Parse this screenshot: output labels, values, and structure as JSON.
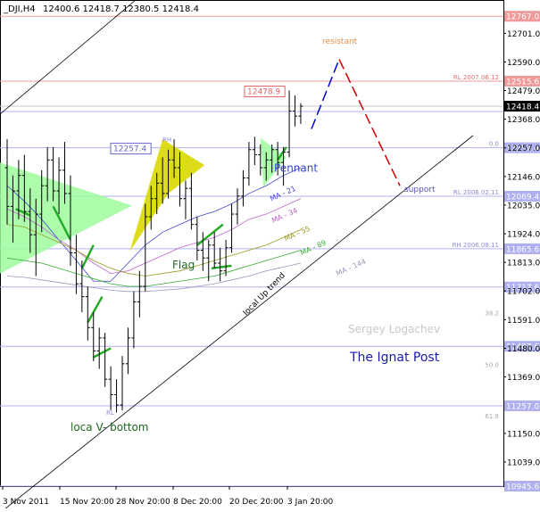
{
  "header": {
    "symbol": "_DJI,H4",
    "ohlc": "12400.6 12418.7 12380.5 12418.4"
  },
  "chart_data": {
    "type": "candlestick",
    "grid": false,
    "ylim": [
      10945.6,
      12767.8
    ],
    "y_ticks": [
      {
        "value": 12767.0,
        "label": "12767.0",
        "boxed": true,
        "kind": "red"
      },
      {
        "value": 12701.0,
        "label": "12701.0"
      },
      {
        "value": 12590.0,
        "label": "12590.0"
      },
      {
        "value": 12515.6,
        "label": "12515.6",
        "boxed": true,
        "kind": "red"
      },
      {
        "value": 12479.0,
        "label": "12479.0"
      },
      {
        "value": 12418.4,
        "label": "12418.4",
        "boxed": true,
        "kind": "current"
      },
      {
        "value": 12368.0,
        "label": "12368.0"
      },
      {
        "value": 12257.4,
        "label": "12257.4",
        "boxed": true,
        "kind": "blue"
      },
      {
        "value": 12257.0,
        "label": "12257.0"
      },
      {
        "value": 12146.0,
        "label": "12146.0"
      },
      {
        "value": 12069.4,
        "label": "12069.4",
        "boxed": true,
        "kind": "blue"
      },
      {
        "value": 12035.0,
        "label": "12035.0"
      },
      {
        "value": 11924.0,
        "label": "11924.0"
      },
      {
        "value": 11865.6,
        "label": "11865.6",
        "boxed": true,
        "kind": "blue"
      },
      {
        "value": 11813.0,
        "label": "11813.0"
      },
      {
        "value": 11717.6,
        "label": "11717.6",
        "boxed": true,
        "kind": "blue"
      },
      {
        "value": 11702.0,
        "label": "11702.0"
      },
      {
        "value": 11591.0,
        "label": "11591.0"
      },
      {
        "value": 11487.6,
        "label": "11487.6",
        "boxed": true,
        "kind": "blue"
      },
      {
        "value": 11480.0,
        "label": "11480.0"
      },
      {
        "value": 11369.0,
        "label": "11369.0"
      },
      {
        "value": 11257.0,
        "label": "11257.0",
        "boxed": true,
        "kind": "blue"
      },
      {
        "value": 11150.0,
        "label": "11150.0"
      },
      {
        "value": 11039.0,
        "label": "11039.0"
      },
      {
        "value": 10945.6,
        "label": "10945.6",
        "boxed": true,
        "kind": "blue"
      }
    ],
    "x_ticks": [
      "3 Nov 2011",
      "15 Nov 20:00",
      "28 Nov 20:00",
      "8 Dec 20:00",
      "20 Dec 20:00",
      "3 Jan 20:00"
    ],
    "horizontal_levels": [
      {
        "value": 12767.0,
        "color": "#ef9a9a"
      },
      {
        "value": 12515.6,
        "color": "#ef9a9a",
        "label": "RL 2007.06.12"
      },
      {
        "value": 12418.4,
        "color": "#c8c8c8"
      },
      {
        "value": 12398.0,
        "color": "#b0b0f0"
      },
      {
        "value": 12257.4,
        "color": "#b0b0f0",
        "label": "0.0"
      },
      {
        "value": 12069.4,
        "color": "#b0b0f0",
        "label": "RL 2006.02.11"
      },
      {
        "value": 11865.6,
        "color": "#b0b0f0",
        "label": "RH 2006.08.11"
      },
      {
        "value": 11717.6,
        "color": "#b0b0f0"
      },
      {
        "value": 11487.6,
        "color": "#b0b0f0"
      },
      {
        "value": 11257.0,
        "color": "#b0b0f0"
      },
      {
        "value": 10945.6,
        "color": "#b0b0f0"
      }
    ],
    "fib_labels": [
      {
        "value": 11608.0,
        "label": "38.2"
      },
      {
        "value": 11407.0,
        "label": "50.0"
      },
      {
        "value": 11208.0,
        "label": "61.8"
      }
    ],
    "candles": [
      {
        "x": "3 Nov 2011",
        "o": 12180,
        "h": 12290,
        "l": 11960,
        "c": 12030
      },
      {
        "o": 12030,
        "h": 12150,
        "l": 11890,
        "c": 12090
      },
      {
        "o": 12090,
        "h": 12210,
        "l": 11980,
        "c": 12150
      },
      {
        "o": 12150,
        "h": 12230,
        "l": 11970,
        "c": 12010
      },
      {
        "o": 12010,
        "h": 12100,
        "l": 11850,
        "c": 11920
      },
      {
        "o": 11920,
        "h": 12060,
        "l": 11760,
        "c": 12000
      },
      {
        "o": 12000,
        "h": 12170,
        "l": 11930,
        "c": 12110
      },
      {
        "o": 12110,
        "h": 12260,
        "l": 12050,
        "c": 12210
      },
      {
        "o": 12210,
        "h": 12260,
        "l": 12050,
        "c": 12090
      },
      {
        "o": 12090,
        "h": 12220,
        "l": 12000,
        "c": 12170
      },
      {
        "o": 12170,
        "h": 12280,
        "l": 12040,
        "c": 12080
      },
      {
        "x": "15 Nov 20:00",
        "o": 12080,
        "h": 12150,
        "l": 11800,
        "c": 11850
      },
      {
        "o": 11850,
        "h": 11920,
        "l": 11690,
        "c": 11730
      },
      {
        "o": 11730,
        "h": 11820,
        "l": 11620,
        "c": 11680
      },
      {
        "o": 11680,
        "h": 11720,
        "l": 11510,
        "c": 11560
      },
      {
        "o": 11560,
        "h": 11620,
        "l": 11430,
        "c": 11470
      },
      {
        "o": 11470,
        "h": 11560,
        "l": 11400,
        "c": 11520
      },
      {
        "o": 11520,
        "h": 11540,
        "l": 11330,
        "c": 11360
      },
      {
        "o": 11360,
        "h": 11410,
        "l": 11240,
        "c": 11300
      },
      {
        "o": 11300,
        "h": 11360,
        "l": 11231,
        "c": 11260
      },
      {
        "o": 11260,
        "h": 11450,
        "l": 11240,
        "c": 11420
      },
      {
        "o": 11420,
        "h": 11560,
        "l": 11380,
        "c": 11520
      },
      {
        "x": "28 Nov 20:00",
        "o": 11520,
        "h": 11700,
        "l": 11480,
        "c": 11660
      },
      {
        "o": 11660,
        "h": 11780,
        "l": 11600,
        "c": 11720
      },
      {
        "o": 11720,
        "h": 12040,
        "l": 11700,
        "c": 11990
      },
      {
        "o": 11990,
        "h": 12110,
        "l": 11940,
        "c": 12060
      },
      {
        "o": 12060,
        "h": 12160,
        "l": 12000,
        "c": 12120
      },
      {
        "o": 12120,
        "h": 12220,
        "l": 12040,
        "c": 12080
      },
      {
        "o": 12080,
        "h": 12250,
        "l": 12060,
        "c": 12210
      },
      {
        "o": 12210,
        "h": 12290,
        "l": 12140,
        "c": 12180
      },
      {
        "o": 12180,
        "h": 12240,
        "l": 12030,
        "c": 12060
      },
      {
        "o": 12060,
        "h": 12130,
        "l": 11980,
        "c": 12100
      },
      {
        "x": "8 Dec 20:00",
        "o": 12100,
        "h": 12160,
        "l": 11940,
        "c": 11960
      },
      {
        "o": 11960,
        "h": 11990,
        "l": 11820,
        "c": 11860
      },
      {
        "o": 11860,
        "h": 11930,
        "l": 11780,
        "c": 11830
      },
      {
        "o": 11830,
        "h": 11900,
        "l": 11740,
        "c": 11880
      },
      {
        "o": 11880,
        "h": 11930,
        "l": 11790,
        "c": 11810
      },
      {
        "o": 11810,
        "h": 11870,
        "l": 11740,
        "c": 11780
      },
      {
        "o": 11780,
        "h": 11900,
        "l": 11760,
        "c": 11870
      },
      {
        "o": 11870,
        "h": 12040,
        "l": 11850,
        "c": 12000
      },
      {
        "o": 12000,
        "h": 12100,
        "l": 11960,
        "c": 12070
      },
      {
        "o": 12070,
        "h": 12170,
        "l": 12030,
        "c": 12140
      },
      {
        "x": "20 Dec 20:00",
        "o": 12140,
        "h": 12280,
        "l": 12110,
        "c": 12250
      },
      {
        "o": 12250,
        "h": 12300,
        "l": 12190,
        "c": 12230
      },
      {
        "o": 12230,
        "h": 12270,
        "l": 12150,
        "c": 12180
      },
      {
        "o": 12180,
        "h": 12240,
        "l": 12130,
        "c": 12210
      },
      {
        "o": 12210,
        "h": 12270,
        "l": 12160,
        "c": 12250
      },
      {
        "o": 12250,
        "h": 12280,
        "l": 12150,
        "c": 12200
      },
      {
        "o": 12200,
        "h": 12260,
        "l": 12110,
        "c": 12240
      },
      {
        "x": "3 Jan 20:00",
        "o": 12240,
        "h": 12479,
        "l": 12220,
        "c": 12400
      },
      {
        "o": 12400,
        "h": 12460,
        "l": 12340,
        "c": 12380
      },
      {
        "o": 12380,
        "h": 12430,
        "l": 12350,
        "c": 12418.4
      }
    ],
    "annotations": {
      "resistant": "resistant",
      "support": "support",
      "pennant": "Pennant",
      "flag": "Flag",
      "bottom": "loca V- bottom",
      "uptrend": "local Up trend",
      "author": "Sergey Logachev",
      "brand": "The Ignat Post",
      "rh": "RH",
      "rl": "RL",
      "box_12478": "12478.9",
      "box_12257": "12257.4",
      "ma21": "MA - 21",
      "ma34": "MA - 34",
      "ma55": "MA - 55",
      "ma89": "MA - 89",
      "ma144": "MA - 144"
    },
    "colors": {
      "candle": "#000000",
      "green_zone": "#9dfc9d",
      "yellow_pattern": "#d8d800",
      "red_level": "#ef9a9a",
      "blue_level": "#b0b0f0",
      "forecast_blue": "#0000cc",
      "forecast_red": "#cc0000",
      "brand": "#1a1aaa",
      "ma21": "#4444cc",
      "ma34": "#bb66cc",
      "ma55": "#9a9a22",
      "ma89": "#33aa33",
      "ma144": "#9999bb"
    }
  }
}
